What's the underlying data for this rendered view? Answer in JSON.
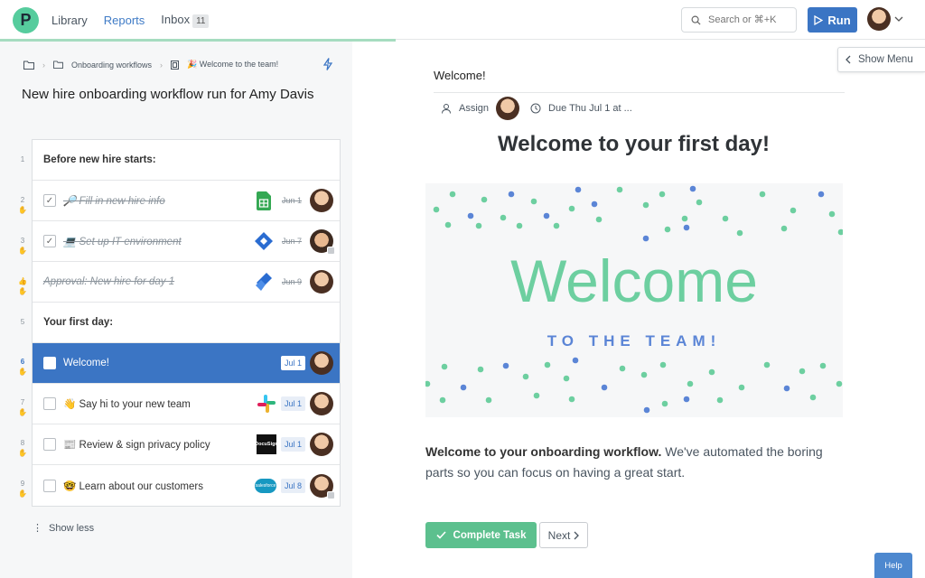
{
  "nav": {
    "logo_letter": "P",
    "library": "Library",
    "reports": "Reports",
    "inbox": "Inbox",
    "inbox_count": "11"
  },
  "search": {
    "placeholder": "Search or ⌘+K"
  },
  "run_label": "Run",
  "breadcrumb": {
    "folder": "Onboarding workflows",
    "template": "🎉 Welcome to the team!"
  },
  "run_title": "New hire onboarding workflow run for Amy Davis",
  "gutter": [
    "1",
    "2",
    "3",
    "",
    "5",
    "6",
    "7",
    "8",
    "9"
  ],
  "tasks": [
    {
      "type": "heading",
      "label": "Before new hire starts:"
    },
    {
      "type": "task",
      "label": "🔎 Fill in new hire info",
      "date": "Jun 1",
      "done": true,
      "app": "sheets-icon"
    },
    {
      "type": "task",
      "label": "💻 Set up IT environment",
      "date": "Jun 7",
      "done": true,
      "app": "jira-icon"
    },
    {
      "type": "task",
      "label": "Approval: New hire for day 1",
      "date": "Jun 9",
      "done": true,
      "app": "jira-icon"
    },
    {
      "type": "heading",
      "label": "Your first day:"
    },
    {
      "type": "task",
      "label": "Welcome!",
      "date": "Jul 1",
      "selected": true
    },
    {
      "type": "task",
      "label": "👋 Say hi to your new team",
      "date": "Jul 1",
      "app": "slack-icon"
    },
    {
      "type": "task",
      "label": "📰 Review & sign privacy policy",
      "date": "Jul 1",
      "app": "docusign-icon"
    },
    {
      "type": "task",
      "label": "🤓 Learn about our customers",
      "date": "Jul 8",
      "app": "salesforce-icon"
    }
  ],
  "show_less": "Show less",
  "task_detail": {
    "title": "Welcome!",
    "assign": "Assign",
    "due": "Due Thu Jul 1 at ...",
    "heading": "Welcome to your first day!",
    "banner_big": "Welcome",
    "banner_small": "TO THE TEAM!",
    "body_bold": "Welcome to your onboarding workflow.",
    "body_rest": " We've automated the boring parts so you can focus on having a great start.",
    "complete": "Complete Task",
    "next": "Next"
  },
  "show_menu": "Show Menu",
  "help": "Help",
  "docusign_text": "DocuSign",
  "salesforce_text": "salesforce",
  "colors": {
    "accent": "#3b75c4",
    "green": "#5cc08e",
    "banner_green": "#6dcfa0",
    "banner_blue": "#5b85d6"
  }
}
